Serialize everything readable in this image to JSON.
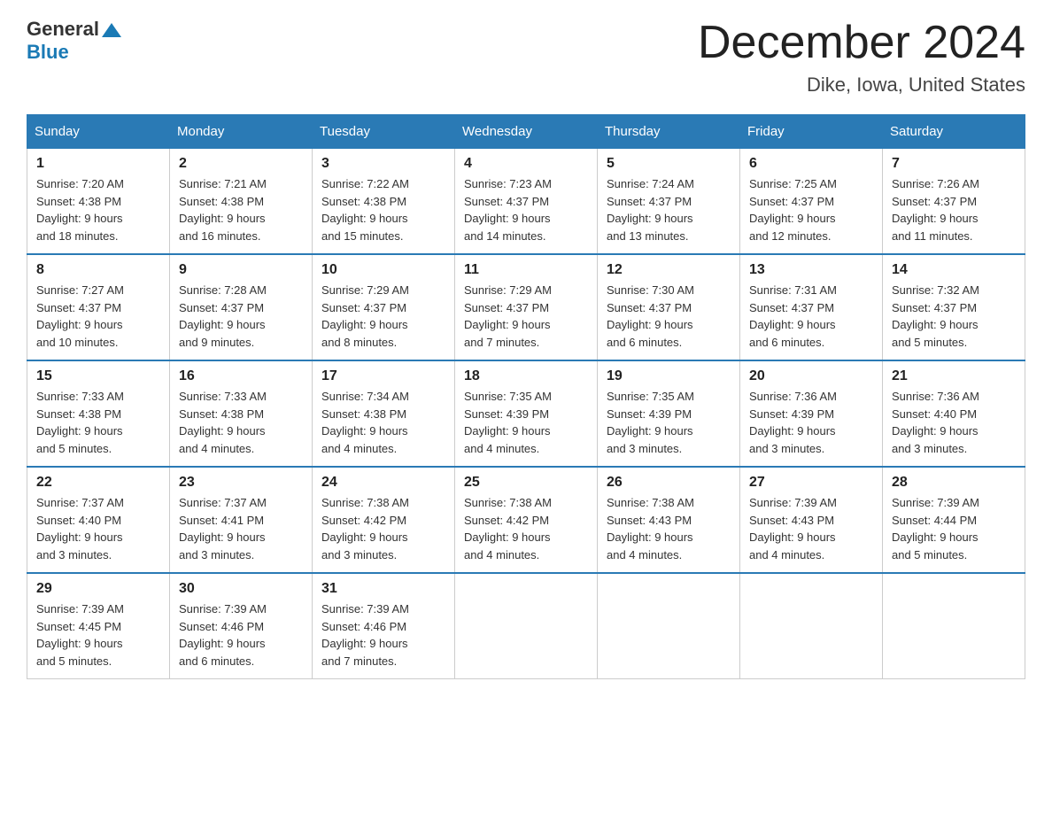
{
  "header": {
    "logo": {
      "general": "General",
      "triangle": "▲",
      "blue": "Blue"
    },
    "title": "December 2024",
    "location": "Dike, Iowa, United States"
  },
  "calendar": {
    "days_of_week": [
      "Sunday",
      "Monday",
      "Tuesday",
      "Wednesday",
      "Thursday",
      "Friday",
      "Saturday"
    ],
    "weeks": [
      [
        {
          "day": "1",
          "sunrise": "7:20 AM",
          "sunset": "4:38 PM",
          "daylight": "9 hours and 18 minutes."
        },
        {
          "day": "2",
          "sunrise": "7:21 AM",
          "sunset": "4:38 PM",
          "daylight": "9 hours and 16 minutes."
        },
        {
          "day": "3",
          "sunrise": "7:22 AM",
          "sunset": "4:38 PM",
          "daylight": "9 hours and 15 minutes."
        },
        {
          "day": "4",
          "sunrise": "7:23 AM",
          "sunset": "4:37 PM",
          "daylight": "9 hours and 14 minutes."
        },
        {
          "day": "5",
          "sunrise": "7:24 AM",
          "sunset": "4:37 PM",
          "daylight": "9 hours and 13 minutes."
        },
        {
          "day": "6",
          "sunrise": "7:25 AM",
          "sunset": "4:37 PM",
          "daylight": "9 hours and 12 minutes."
        },
        {
          "day": "7",
          "sunrise": "7:26 AM",
          "sunset": "4:37 PM",
          "daylight": "9 hours and 11 minutes."
        }
      ],
      [
        {
          "day": "8",
          "sunrise": "7:27 AM",
          "sunset": "4:37 PM",
          "daylight": "9 hours and 10 minutes."
        },
        {
          "day": "9",
          "sunrise": "7:28 AM",
          "sunset": "4:37 PM",
          "daylight": "9 hours and 9 minutes."
        },
        {
          "day": "10",
          "sunrise": "7:29 AM",
          "sunset": "4:37 PM",
          "daylight": "9 hours and 8 minutes."
        },
        {
          "day": "11",
          "sunrise": "7:29 AM",
          "sunset": "4:37 PM",
          "daylight": "9 hours and 7 minutes."
        },
        {
          "day": "12",
          "sunrise": "7:30 AM",
          "sunset": "4:37 PM",
          "daylight": "9 hours and 6 minutes."
        },
        {
          "day": "13",
          "sunrise": "7:31 AM",
          "sunset": "4:37 PM",
          "daylight": "9 hours and 6 minutes."
        },
        {
          "day": "14",
          "sunrise": "7:32 AM",
          "sunset": "4:37 PM",
          "daylight": "9 hours and 5 minutes."
        }
      ],
      [
        {
          "day": "15",
          "sunrise": "7:33 AM",
          "sunset": "4:38 PM",
          "daylight": "9 hours and 5 minutes."
        },
        {
          "day": "16",
          "sunrise": "7:33 AM",
          "sunset": "4:38 PM",
          "daylight": "9 hours and 4 minutes."
        },
        {
          "day": "17",
          "sunrise": "7:34 AM",
          "sunset": "4:38 PM",
          "daylight": "9 hours and 4 minutes."
        },
        {
          "day": "18",
          "sunrise": "7:35 AM",
          "sunset": "4:39 PM",
          "daylight": "9 hours and 4 minutes."
        },
        {
          "day": "19",
          "sunrise": "7:35 AM",
          "sunset": "4:39 PM",
          "daylight": "9 hours and 3 minutes."
        },
        {
          "day": "20",
          "sunrise": "7:36 AM",
          "sunset": "4:39 PM",
          "daylight": "9 hours and 3 minutes."
        },
        {
          "day": "21",
          "sunrise": "7:36 AM",
          "sunset": "4:40 PM",
          "daylight": "9 hours and 3 minutes."
        }
      ],
      [
        {
          "day": "22",
          "sunrise": "7:37 AM",
          "sunset": "4:40 PM",
          "daylight": "9 hours and 3 minutes."
        },
        {
          "day": "23",
          "sunrise": "7:37 AM",
          "sunset": "4:41 PM",
          "daylight": "9 hours and 3 minutes."
        },
        {
          "day": "24",
          "sunrise": "7:38 AM",
          "sunset": "4:42 PM",
          "daylight": "9 hours and 3 minutes."
        },
        {
          "day": "25",
          "sunrise": "7:38 AM",
          "sunset": "4:42 PM",
          "daylight": "9 hours and 4 minutes."
        },
        {
          "day": "26",
          "sunrise": "7:38 AM",
          "sunset": "4:43 PM",
          "daylight": "9 hours and 4 minutes."
        },
        {
          "day": "27",
          "sunrise": "7:39 AM",
          "sunset": "4:43 PM",
          "daylight": "9 hours and 4 minutes."
        },
        {
          "day": "28",
          "sunrise": "7:39 AM",
          "sunset": "4:44 PM",
          "daylight": "9 hours and 5 minutes."
        }
      ],
      [
        {
          "day": "29",
          "sunrise": "7:39 AM",
          "sunset": "4:45 PM",
          "daylight": "9 hours and 5 minutes."
        },
        {
          "day": "30",
          "sunrise": "7:39 AM",
          "sunset": "4:46 PM",
          "daylight": "9 hours and 6 minutes."
        },
        {
          "day": "31",
          "sunrise": "7:39 AM",
          "sunset": "4:46 PM",
          "daylight": "9 hours and 7 minutes."
        },
        null,
        null,
        null,
        null
      ]
    ],
    "labels": {
      "sunrise": "Sunrise:",
      "sunset": "Sunset:",
      "daylight": "Daylight:"
    }
  }
}
